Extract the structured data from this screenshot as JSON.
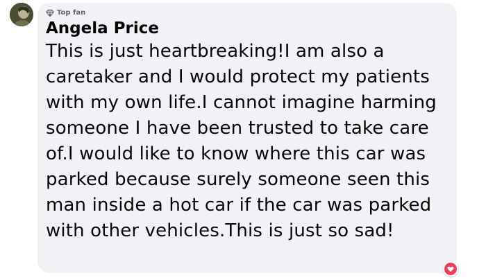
{
  "comment": {
    "badge_icon": "diamond-icon",
    "badge_label": "Top fan",
    "author": "Angela Price",
    "text": "This is just heartbreaking!I am also a caretaker and I would protect my patients with my own life.I cannot imagine harming someone I have been trusted to take care of.I would like to know where this car was parked because surely someone seen this man inside a hot car if the car was parked with other vehicles.This is just so sad!",
    "reaction_icon": "love-reaction-icon"
  },
  "colors": {
    "bubble": "#f0f2f5",
    "text": "#050505",
    "meta": "#65676b",
    "love": "#f33e58"
  }
}
